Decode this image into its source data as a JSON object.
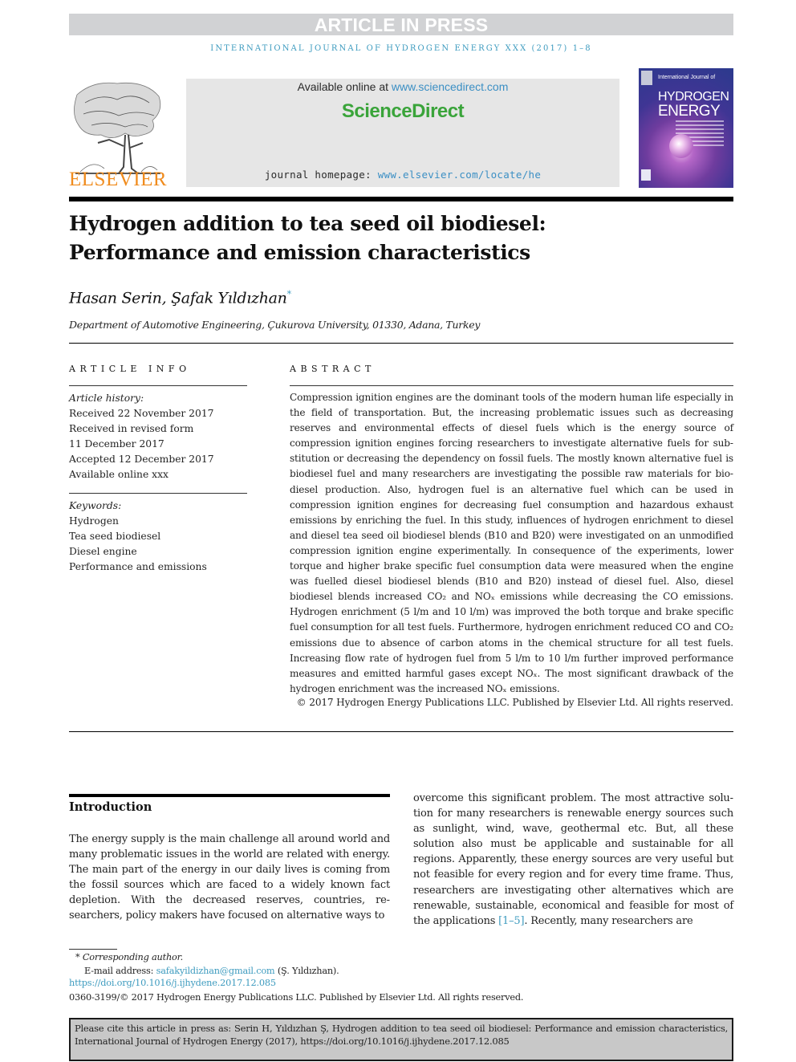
{
  "banner": {
    "status": "ARTICLE IN PRESS"
  },
  "journal_line": "INTERNATIONAL JOURNAL OF HYDROGEN ENERGY XXX (2017) 1–8",
  "header": {
    "publisher_logo_text": "ELSEVIER",
    "available_prefix": "Available online at ",
    "available_link": "www.sciencedirect.com",
    "platform_logo_text": "ScienceDirect",
    "homepage_prefix": "journal homepage: ",
    "homepage_link": "www.elsevier.com/locate/he",
    "cover": {
      "line1": "International Journal of",
      "line2": "HYDROGEN",
      "line3": "ENERGY"
    }
  },
  "article": {
    "title_line1": "Hydrogen addition to tea seed oil biodiesel:",
    "title_line2": "Performance and emission characteristics",
    "authors": "Hasan Serin, Şafak Yıldızhan",
    "corresponding_mark": "*",
    "affiliation": "Department of Automotive Engineering, Çukurova University, 01330, Adana, Turkey"
  },
  "article_info": {
    "heading": "ARTICLE INFO",
    "history_label": "Article history:",
    "history": [
      "Received 22 November 2017",
      "Received in revised form",
      "11 December 2017",
      "Accepted 12 December 2017",
      "Available online xxx"
    ],
    "keywords_label": "Keywords:",
    "keywords": [
      "Hydrogen",
      "Tea seed biodiesel",
      "Diesel engine",
      "Performance and emissions"
    ]
  },
  "abstract": {
    "heading": "ABSTRACT",
    "text": "Compression ignition engines are the dominant tools of the modern human life especially in the field of transportation. But, the increasing problematic issues such as decreasing reserves and environmental effects of diesel fuels which is the energy source of compression ignition engines forcing researchers to investigate alternative fuels for sub­stitution or decreasing the dependency on fossil fuels. The mostly known alternative fuel is biodiesel fuel and many researchers are investigating the possible raw materials for bio­diesel production. Also, hydrogen fuel is an alternative fuel which can be used in compression ignition engines for decreasing fuel consumption and hazardous exhaust emissions by enriching the fuel. In this study, influences of hydrogen enrichment to diesel and diesel tea seed oil biodiesel blends (B10 and B20) were investigated on an unmodified compression ignition engine experimentally. In consequence of the experiments, lower torque and higher brake specific fuel consumption data were measured when the engine was fuelled diesel biodiesel blends (B10 and B20) instead of diesel fuel. Also, diesel biodiesel blends increased CO₂ and NOₓ emissions while decreasing the CO emissions. Hydrogen enrichment (5 l/m and 10 l/m) was improved the both torque and brake specific fuel con­sumption for all test fuels. Furthermore, hydrogen enrichment reduced CO and CO₂ emissions due to absence of carbon atoms in the chemical structure for all test fuels. Increasing flow rate of hydrogen fuel from 5 l/m to 10 l/m further improved performance measures and emitted harmful gases except NOₓ. The most significant drawback of the hydrogen enrichment was the increased NOₓ emissions.",
    "copyright": "© 2017 Hydrogen Energy Publications LLC. Published by Elsevier Ltd. All rights reserved."
  },
  "introduction": {
    "heading": "Introduction",
    "left_text": "The energy supply is the main challenge all around world and many problematic issues in the world are related with energy. The main part of the energy in our daily lives is coming from the fossil sources which are faced to a widely known fact depletion. With the decreased reserves, countries, re­searchers, policy makers have focused on alternative ways to",
    "right_text_before_ref": "overcome this significant problem. The most attractive solu­tion for many researchers is renewable energy sources such as sunlight, wind, wave, geothermal etc. But, all these solution also must be applicable and sustainable for all regions. Apparently, these energy sources are very useful but not feasible for every region and for every time frame. Thus, re­searchers are investigating other alternatives which are renewable, sustainable, economical and feasible for most of the applications ",
    "ref": "[1–5]",
    "right_text_after_ref": ". Recently, many researchers are"
  },
  "footnotes": {
    "corresponding": "* Corresponding author.",
    "email_label": "E-mail address: ",
    "email": "safakyildizhan@gmail.com",
    "email_suffix": " (Ş. Yıldızhan).",
    "doi": "https://doi.org/10.1016/j.ijhydene.2017.12.085",
    "issn": "0360-3199/© 2017 Hydrogen Energy Publications LLC. Published by Elsevier Ltd. All rights reserved."
  },
  "citation_box": "Please cite this article in press as: Serin H, Yıldızhan Ş, Hydrogen addition to tea seed oil biodiesel: Performance and emission char­acteristics, International Journal of Hydrogen Energy (2017), https://doi.org/10.1016/j.ijhydene.2017.12.085",
  "colors": {
    "link": "#3d9bbf",
    "elsevier_orange": "#f08c1e",
    "sciencedirect_green": "#3aa43a",
    "banner_gray": "#d1d2d4"
  }
}
